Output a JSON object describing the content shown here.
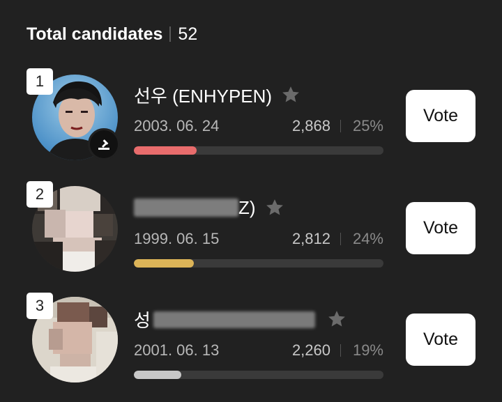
{
  "header": {
    "label": "Total candidates",
    "count": "52"
  },
  "candidates": [
    {
      "rank": "1",
      "name": "선우 (ENHYPEN)",
      "birthdate": "2003. 06. 24",
      "votes": "2,868",
      "percent": "25%",
      "share": 0.25,
      "bar_color": "#e86c6c",
      "vote_label": "Vote",
      "has_badge": true,
      "badge_icon": "vote-stamp-icon"
    },
    {
      "rank": "2",
      "name": "Z)",
      "birthdate": "1999. 06. 15",
      "votes": "2,812",
      "percent": "24%",
      "share": 0.24,
      "bar_color": "#dcb458",
      "vote_label": "Vote",
      "has_badge": false
    },
    {
      "rank": "3",
      "name": "성",
      "birthdate": "2001. 06. 13",
      "votes": "2,260",
      "percent": "19%",
      "share": 0.19,
      "bar_color": "#c8c8c8",
      "vote_label": "Vote",
      "has_badge": false
    }
  ],
  "colors": {
    "background": "#212121",
    "bar_track": "#3a3a3a",
    "star": "#6b6b6b"
  }
}
